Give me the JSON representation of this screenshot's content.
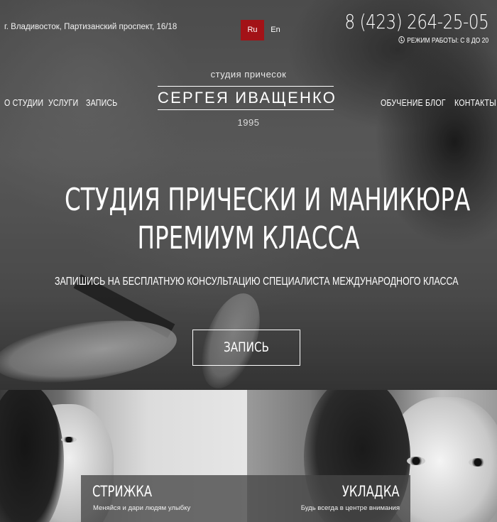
{
  "header": {
    "address": "г. Владивосток, Партизанский проспект, 16/18",
    "lang_ru": "Ru",
    "lang_en": "En",
    "phone": "8 (423) 264-25-05",
    "hours": "РЕЖИМ РАБОТЫ: С 8 ДО 20"
  },
  "nav": {
    "left": [
      "О СТУДИИ",
      "УСЛУГИ",
      "ЗАПИСЬ"
    ],
    "right": [
      "ОБУЧЕНИЕ",
      "БЛОГ",
      "КОНТАКТЫ"
    ]
  },
  "logo": {
    "subtitle": "студия причесок",
    "name": "СЕРГЕЯ ИВАЩЕНКО",
    "year": "1995"
  },
  "hero": {
    "headline_line1": "СТУДИЯ ПРИЧЕСКИ И МАНИКЮРА",
    "headline_line2": "ПРЕМИУМ КЛАССА",
    "subline": "ЗАПИШИСЬ НА БЕСПЛАТНУЮ КОНСУЛЬТАЦИЮ СПЕЦИАЛИСТА МЕЖДУНАРОДНОГО КЛАССА",
    "cta_label": "ЗАПИСЬ"
  },
  "services": [
    {
      "title": "СТРИЖКА",
      "subtitle": "Меняйся и дари людям улыбку"
    },
    {
      "title": "УКЛАДКА",
      "subtitle": "Будь всегда в центре внимания"
    }
  ],
  "colors": {
    "accent": "#a31217"
  },
  "icons": {
    "hours": "clock-icon"
  }
}
